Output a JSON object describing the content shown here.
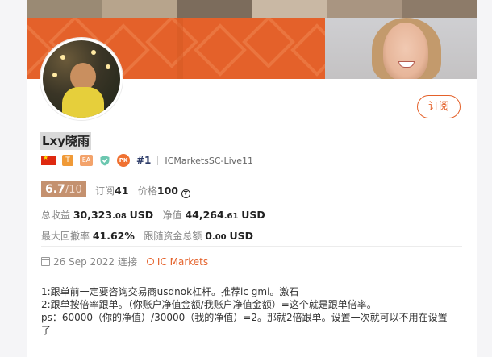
{
  "profile": {
    "name": "Lxy晓雨",
    "subscribe_label": "订阅",
    "rank": "#1",
    "server": "ICMarketsSC-Live11",
    "badges": {
      "t": "T",
      "ea": "EA",
      "pk": "PK"
    }
  },
  "stats": {
    "score": "6.7",
    "score_max": "/10",
    "subscribers_label": "订阅",
    "subscribers": "41",
    "price_label": "价格",
    "price": "100",
    "total_profit_label": "总收益",
    "total_profit_main": "30,323",
    "total_profit_dec": ".08",
    "total_profit_unit": "USD",
    "equity_label": "净值",
    "equity_main": "44,264",
    "equity_dec": ".61",
    "equity_unit": "USD",
    "max_drawdown_label": "最大回撤率",
    "max_drawdown": "41.62%",
    "copy_funds_label": "跟随资金总额",
    "copy_funds_main": "0",
    "copy_funds_dec": ".00",
    "copy_funds_unit": "USD"
  },
  "meta": {
    "date": "26 Sep 2022",
    "connect_label": "连接",
    "broker": "IC Markets"
  },
  "description": [
    "1:跟单前一定要咨询交易商usdnok杠杆。推荐ic gmi。激石",
    "2:跟单按倍率跟单。（你账户净值金额/我账户净值金额）=这个就是跟单倍率。",
    "ps：60000（你的净值）/30000（我的净值）=2。那就2倍跟单。设置一次就可以不用在设置",
    "了"
  ],
  "colors": {
    "accent": "#e4612a",
    "score_bg": "#c4916f",
    "rank": "#2b3a67"
  },
  "icons": [
    "china-flag-icon",
    "shield-check-icon",
    "pk-icon",
    "calendar-icon",
    "location-pin-icon",
    "coin-icon"
  ]
}
